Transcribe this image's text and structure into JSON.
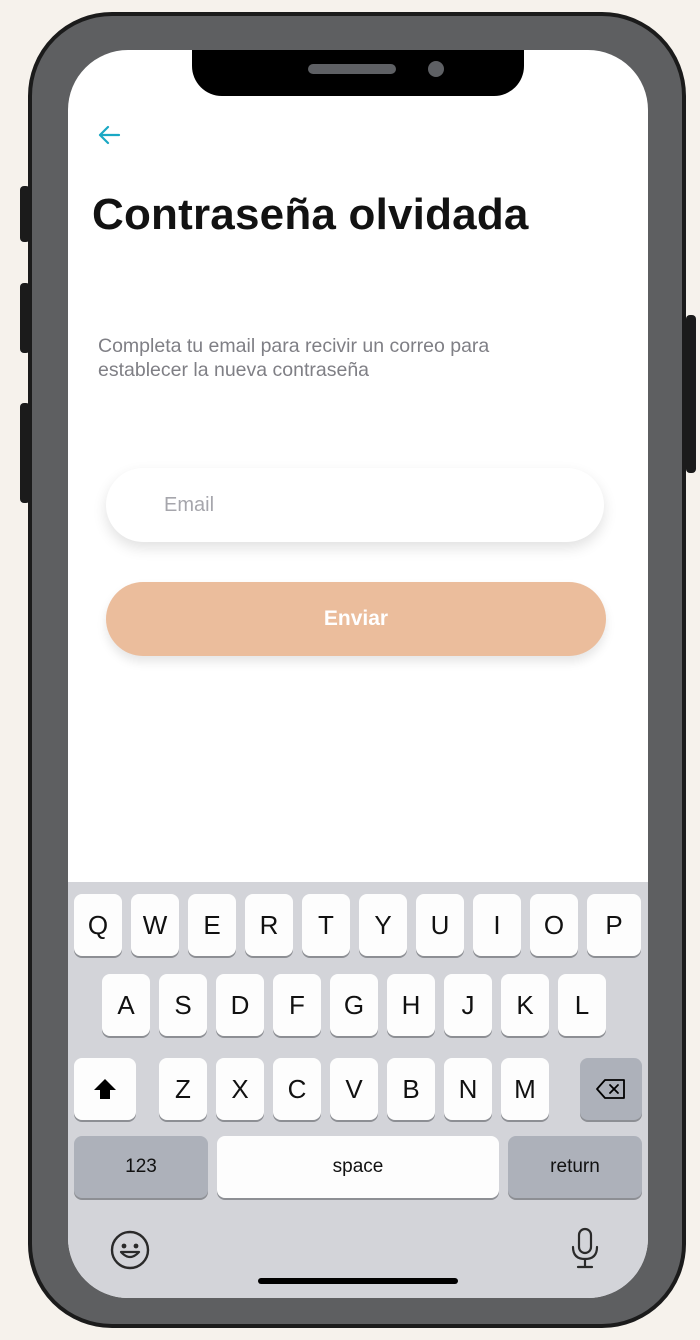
{
  "screen": {
    "title": "Contraseña olvidada",
    "subtitle": "Completa tu email para recivir un correo para establecer la nueva contraseña",
    "email_placeholder": "Email",
    "send_label": "Enviar"
  },
  "icons": {
    "back": "back-arrow-icon",
    "shift": "shift-icon",
    "backspace": "backspace-icon",
    "emoji": "emoji-icon",
    "microphone": "microphone-icon"
  },
  "colors": {
    "accent": "#1aa8c4",
    "button": "#ebbd9c",
    "keyboard_bg": "#d3d4d9",
    "phone_frame": "#5e5f61"
  },
  "keyboard": {
    "row1": [
      "Q",
      "W",
      "E",
      "R",
      "T",
      "Y",
      "U",
      "I",
      "O",
      "P"
    ],
    "row2": [
      "A",
      "S",
      "D",
      "F",
      "G",
      "H",
      "J",
      "K",
      "L"
    ],
    "row3": [
      "Z",
      "X",
      "C",
      "V",
      "B",
      "N",
      "M"
    ],
    "numbers_label": "123",
    "space_label": "space",
    "return_label": "return"
  }
}
